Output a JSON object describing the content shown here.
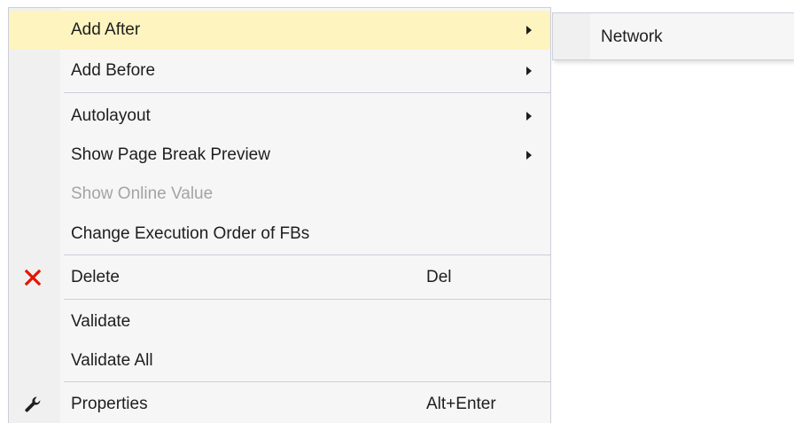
{
  "context_menu": {
    "items": [
      {
        "label": "Add After",
        "has_submenu": true,
        "highlighted": true
      },
      {
        "label": "Add Before",
        "has_submenu": true
      },
      {
        "label": "Autolayout",
        "has_submenu": true
      },
      {
        "label": "Show Page Break Preview",
        "has_submenu": true
      },
      {
        "label": "Show Online Value",
        "disabled": true
      },
      {
        "label": "Change Execution Order of FBs"
      },
      {
        "label": "Delete",
        "shortcut": "Del",
        "icon": "delete-x-icon"
      },
      {
        "label": "Validate"
      },
      {
        "label": "Validate All"
      },
      {
        "label": "Properties",
        "shortcut": "Alt+Enter",
        "icon": "wrench-icon"
      }
    ]
  },
  "submenu": {
    "items": [
      {
        "label": "Network"
      }
    ]
  },
  "colors": {
    "menu_bg": "#f6f6f6",
    "highlight": "#fdf4bf",
    "separator": "#cccedb",
    "text": "#1e1e1e",
    "disabled_text": "#a2a4a5",
    "delete_icon": "#e51400"
  }
}
